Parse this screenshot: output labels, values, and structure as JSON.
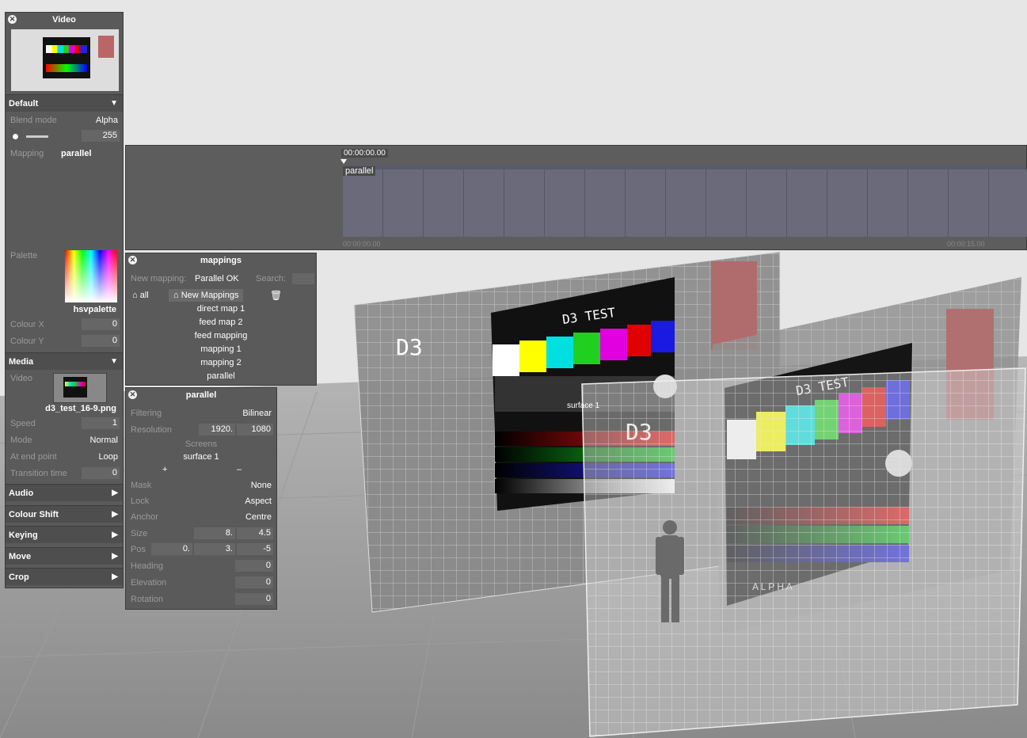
{
  "video_panel": {
    "title": "Video",
    "default_section": "Default",
    "blend_mode_label": "Blend mode",
    "blend_mode_value": "Alpha",
    "opacity_value": "255",
    "mapping_label": "Mapping",
    "mapping_value": "parallel",
    "palette_label": "Palette",
    "palette_value": "hsvpalette",
    "colour_x_label": "Colour X",
    "colour_x_value": "0",
    "colour_y_label": "Colour Y",
    "colour_y_value": "0",
    "media_section": "Media",
    "video_label": "Video",
    "video_file": "d3_test_16-9.png",
    "speed_label": "Speed",
    "speed_value": "1",
    "mode_label": "Mode",
    "mode_value": "Normal",
    "end_point_label": "At end point",
    "end_point_value": "Loop",
    "transition_label": "Transition time",
    "transition_value": "0",
    "sections": [
      "Audio",
      "Colour Shift",
      "Keying",
      "Move",
      "Crop"
    ]
  },
  "timeline": {
    "timecode_top": "00:00:00.00",
    "clip_label": "parallel",
    "timecode_start": "00:00:00.00",
    "timecode_end": "00:00:15.00"
  },
  "mappings_panel": {
    "title": "mappings",
    "new_mapping_label": "New mapping:",
    "new_mapping_value": "Parallel OK",
    "search_label": "Search:",
    "all_button": "all",
    "new_mappings_button": "New Mappings",
    "items": [
      "direct map 1",
      "feed map 2",
      "feed mapping",
      "mapping 1",
      "mapping 2",
      "parallel"
    ]
  },
  "parallel_panel": {
    "title": "parallel",
    "filtering_label": "Filtering",
    "filtering_value": "Bilinear",
    "resolution_label": "Resolution",
    "resolution_w": "1920.",
    "resolution_h": "1080",
    "screens_label": "Screens",
    "screen_item": "surface 1",
    "add_symbol": "+",
    "remove_symbol": "–",
    "mask_label": "Mask",
    "mask_value": "None",
    "lock_label": "Lock",
    "lock_value": "Aspect",
    "anchor_label": "Anchor",
    "anchor_value": "Centre",
    "size_label": "Size",
    "size_x": "8.",
    "size_y": "4.5",
    "pos_label": "Pos",
    "pos_x": "0.",
    "pos_y": "3.",
    "pos_z": "-5",
    "heading_label": "Heading",
    "heading_value": "0",
    "elevation_label": "Elevation",
    "elevation_value": "0",
    "rotation_label": "Rotation",
    "rotation_value": "0"
  },
  "viewport": {
    "test_title": "D3 TEST",
    "surface_label": "surface 1",
    "d3_text": "D3",
    "alpha_text": "A L P H A"
  }
}
